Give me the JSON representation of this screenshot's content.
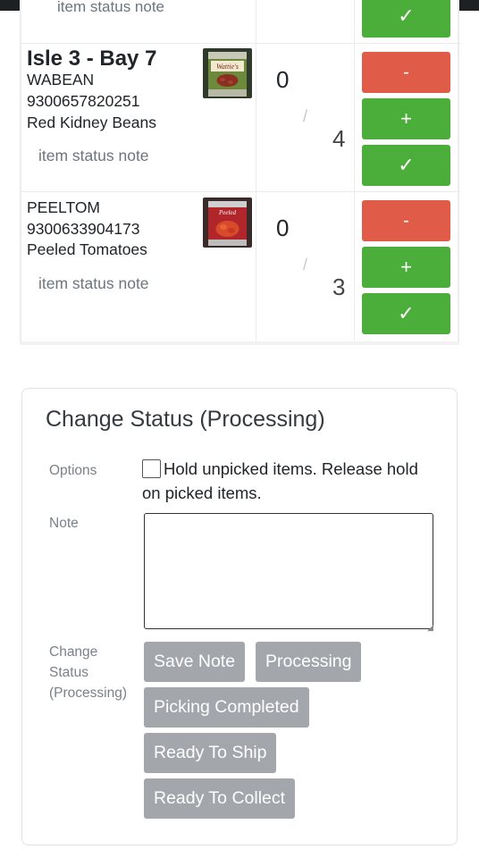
{
  "previous_item": {
    "status_note_partial": "item status note",
    "done_symbol": "✓"
  },
  "items": [
    {
      "location": "Isle 3 - Bay 7",
      "code": "WABEAN",
      "barcode": "9300657820251",
      "name": "Red Kidney Beans",
      "status_note_placeholder": "item status note",
      "image_label": "Wattie's",
      "picked": "0",
      "slash": "/",
      "total": "4",
      "minus_label": "-",
      "plus_label": "+",
      "done_label": "✓"
    },
    {
      "location": "",
      "code": "PEELTOM",
      "barcode": "9300633904173",
      "name": "Peeled Tomatoes",
      "status_note_placeholder": "item status note",
      "image_label": "Peeled",
      "picked": "0",
      "slash": "/",
      "total": "3",
      "minus_label": "-",
      "plus_label": "+",
      "done_label": "✓"
    }
  ],
  "change_status": {
    "title": "Change Status (Processing)",
    "options_label": "Options",
    "option_text": "Hold unpicked items. Release hold on picked items.",
    "option_checked": false,
    "note_label": "Note",
    "note_value": "",
    "status_label_line1": "Change",
    "status_label_line2": "Status",
    "status_label_line3": "(Processing)",
    "buttons": {
      "save_note": "Save Note",
      "processing": "Processing",
      "picking_completed": "Picking Completed",
      "ready_to_ship": "Ready To Ship",
      "ready_to_collect": "Ready To Collect"
    }
  },
  "colors": {
    "minus": "#e15c48",
    "plus": "#4cae3a",
    "status_button": "#a3a7ac"
  }
}
